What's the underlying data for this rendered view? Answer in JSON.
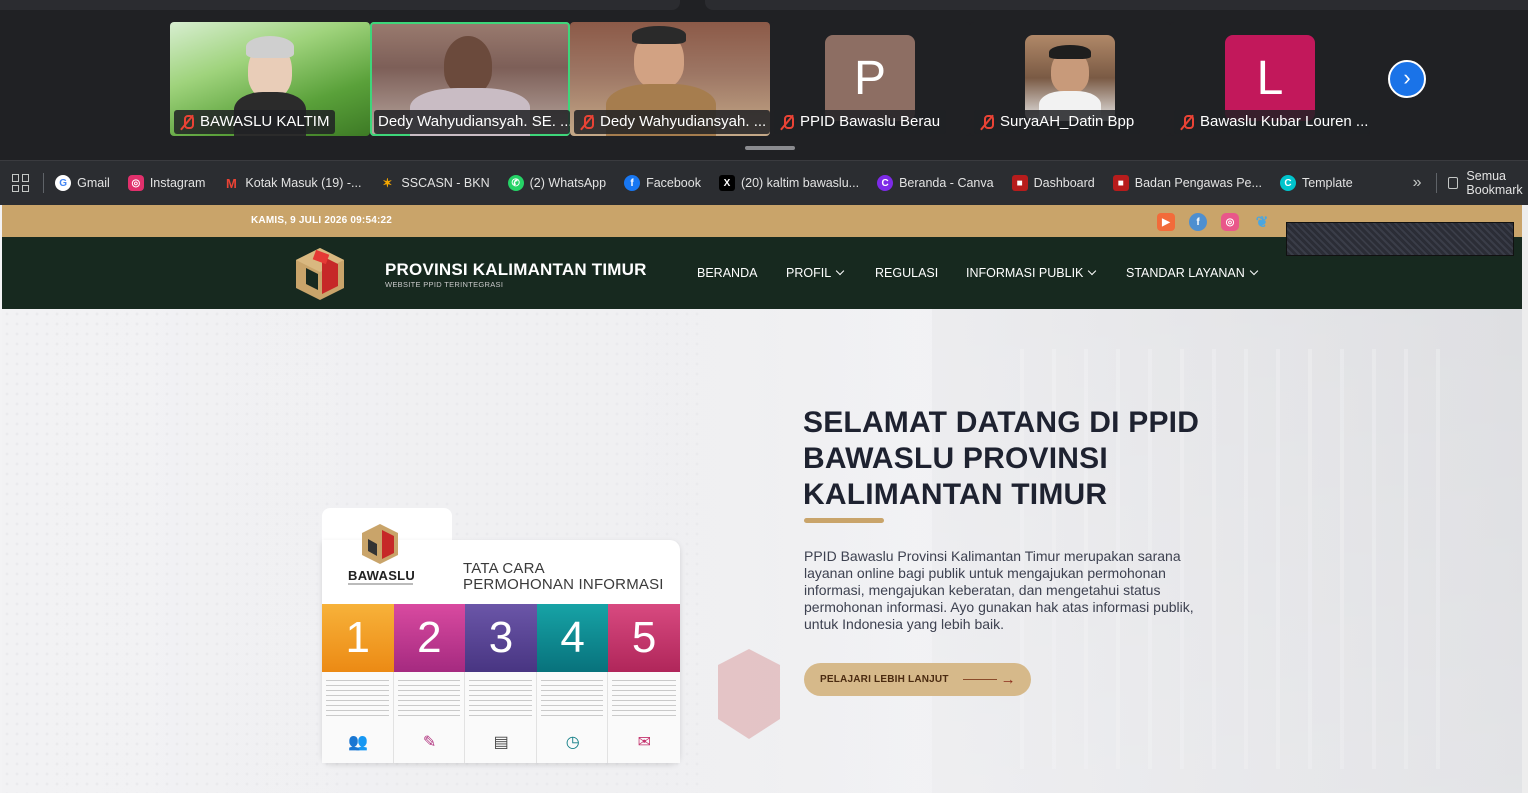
{
  "call": {
    "participants": [
      {
        "name": "BAWASLU KALTIM",
        "muted": true,
        "kind": "video"
      },
      {
        "name": "Dedy Wahyudiansyah. SE. ...",
        "muted": false,
        "kind": "video",
        "active": true
      },
      {
        "name": "Dedy Wahyudiansyah. ...",
        "muted": true,
        "kind": "video"
      },
      {
        "name": "PPID Bawaslu Berau",
        "muted": true,
        "kind": "initial",
        "initial": "P",
        "color": "#8d6e63"
      },
      {
        "name": "SuryaAH_Datin Bpp",
        "muted": true,
        "kind": "photo"
      },
      {
        "name": "Bawaslu Kubar Louren ...",
        "muted": true,
        "kind": "initial",
        "initial": "L",
        "color": "#c2185b"
      }
    ],
    "next_icon": "chevron-right-icon"
  },
  "bookmarks": {
    "items": [
      {
        "label": "Gmail",
        "icon": "google-icon",
        "color": "#4285f4"
      },
      {
        "label": "Instagram",
        "icon": "instagram-icon",
        "color": "#e1306c"
      },
      {
        "label": "Kotak Masuk (19) -...",
        "icon": "gmail-icon",
        "color": "#ea4335"
      },
      {
        "label": "SSCASN - BKN",
        "icon": "sscasn-icon",
        "color": "#f6a700"
      },
      {
        "label": "(2) WhatsApp",
        "icon": "whatsapp-icon",
        "color": "#25d366"
      },
      {
        "label": "Facebook",
        "icon": "facebook-icon",
        "color": "#1877f2"
      },
      {
        "label": "(20) kaltim bawaslu...",
        "icon": "x-icon",
        "color": "#000000"
      },
      {
        "label": "Beranda - Canva",
        "icon": "canva-icon",
        "color": "#7d2ae8"
      },
      {
        "label": "Dashboard",
        "icon": "bawaslu-icon",
        "color": "#b71c1c"
      },
      {
        "label": "Badan Pengawas Pe...",
        "icon": "bawaslu-icon",
        "color": "#b71c1c"
      },
      {
        "label": "Template",
        "icon": "canva-icon",
        "color": "#00c4cc"
      }
    ],
    "more": "»",
    "all_bookmarks": "Semua Bookmark"
  },
  "site": {
    "date": "KAMIS, 9 JULI 2026 09:54:22",
    "social": [
      {
        "icon": "youtube-icon",
        "color": "#f26b3a",
        "glyph": "▶"
      },
      {
        "icon": "facebook-icon",
        "color": "#4e8fd0",
        "glyph": "f"
      },
      {
        "icon": "instagram-icon",
        "color": "#e9578a",
        "glyph": "◎"
      },
      {
        "icon": "twitter-icon",
        "color": "#4aa6e0",
        "glyph": "t"
      }
    ],
    "brand_title": "PROVINSI KALIMANTAN TIMUR",
    "brand_sub": "WEBSITE PPID TERINTEGRASI",
    "nav": {
      "beranda": "BERANDA",
      "profil": "PROFIL",
      "regulasi": "REGULASI",
      "informasi_publik": "INFORMASI PUBLIK",
      "standar_layanan": "STANDAR LAYANAN"
    },
    "hero": {
      "title": "SELAMAT DATANG DI PPID BAWASLU PROVINSI KALIMANTAN TIMUR",
      "description": "PPID Bawaslu Provinsi Kalimantan Timur merupakan sarana layanan online bagi publik untuk mengajukan permohonan informasi, mengajukan keberatan, dan mengetahui status permohonan informasi. Ayo gunakan hak atas informasi publik, untuk Indonesia yang lebih baik.",
      "cta": "PELAJARI LEBIH LANJUT"
    },
    "infographic": {
      "brand": "BAWASLU",
      "heading_line1": "TATA CARA",
      "heading_line2": "PERMOHONAN INFORMASI",
      "steps": [
        {
          "number": "1",
          "color": "#f39a1e",
          "icon": "people-meeting-icon",
          "glyph": "👥"
        },
        {
          "number": "2",
          "color": "#c2378f",
          "icon": "pen-form-icon",
          "glyph": "✎"
        },
        {
          "number": "3",
          "color": "#5a4597",
          "icon": "document-search-icon",
          "glyph": "▤"
        },
        {
          "number": "4",
          "color": "#0e8a92",
          "icon": "clock-icon",
          "glyph": "◷"
        },
        {
          "number": "5",
          "color": "#c4326d",
          "icon": "envelope-icon",
          "glyph": "✉"
        }
      ]
    }
  }
}
